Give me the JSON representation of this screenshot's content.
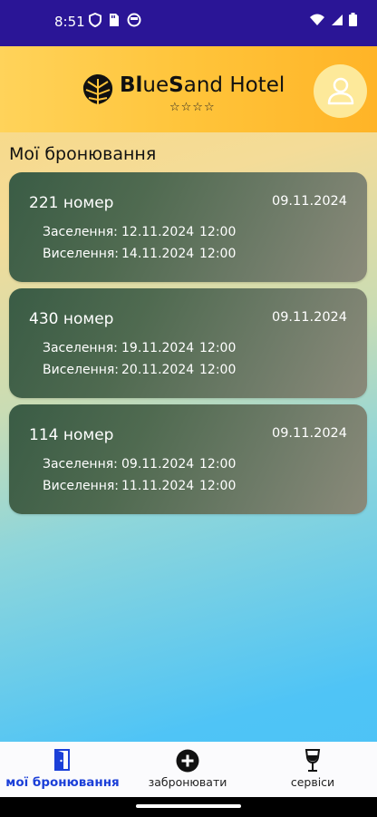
{
  "status_bar": {
    "time": "8:51"
  },
  "header": {
    "brand_bold_1": "Blue",
    "brand_bold_2": "S",
    "brand_rest": "and Hotel",
    "brand_part_ue": "ue",
    "stars": "☆☆☆☆"
  },
  "page": {
    "title": "Мої бронювання"
  },
  "bookings": [
    {
      "room": "221 номер",
      "created": "09.11.2024",
      "checkin_label": "Заселення:",
      "checkin_date": "12.11.2024",
      "checkin_time": "12:00",
      "checkout_label": "Виселення:",
      "checkout_date": "14.11.2024",
      "checkout_time": "12:00"
    },
    {
      "room": "430 номер",
      "created": "09.11.2024",
      "checkin_label": "Заселення:",
      "checkin_date": "19.11.2024",
      "checkin_time": "12:00",
      "checkout_label": "Виселення:",
      "checkout_date": "20.11.2024",
      "checkout_time": "12:00"
    },
    {
      "room": "114 номер",
      "created": "09.11.2024",
      "checkin_label": "Заселення:",
      "checkin_date": "09.11.2024",
      "checkin_time": "12:00",
      "checkout_label": "Виселення:",
      "checkout_date": "11.11.2024",
      "checkout_time": "12:00"
    }
  ],
  "nav": {
    "my_bookings": "мої бронювання",
    "book": "забронювати",
    "services": "сервіси"
  },
  "colors": {
    "accent": "#1b3fd8",
    "status_bar": "#2a1596",
    "header": "#ffc43a"
  }
}
